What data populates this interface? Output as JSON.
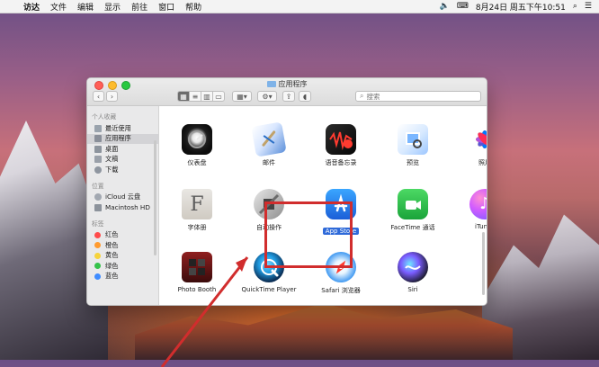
{
  "menubar": {
    "items": [
      "访达",
      "文件",
      "编辑",
      "显示",
      "前往",
      "窗口",
      "帮助"
    ],
    "datetime": "8月24日 周五下午10:51"
  },
  "window": {
    "title": "应用程序",
    "search_placeholder": "搜索"
  },
  "sidebar": {
    "favorites_header": "个人收藏",
    "favorites": [
      "最近使用",
      "应用程序",
      "桌面",
      "文稿",
      "下载"
    ],
    "devices_header": "位置",
    "devices": [
      "iCloud 云盘",
      "Macintosh HD"
    ],
    "tags_header": "标签",
    "tags": [
      {
        "label": "红色",
        "color": "#ff4b4b"
      },
      {
        "label": "橙色",
        "color": "#ff9a2e"
      },
      {
        "label": "黄色",
        "color": "#f6d33c"
      },
      {
        "label": "绿色",
        "color": "#35c24a"
      },
      {
        "label": "蓝色",
        "color": "#3f8cff"
      }
    ]
  },
  "apps": [
    {
      "label": "仪表盘",
      "icon": "dashboard-icon"
    },
    {
      "label": "邮件",
      "icon": "mail-icon"
    },
    {
      "label": "语音备忘录",
      "icon": "voice-memos-icon"
    },
    {
      "label": "预览",
      "icon": "preview-icon"
    },
    {
      "label": "照片",
      "icon": "photos-icon"
    },
    {
      "label": "字体册",
      "icon": "font-book-icon"
    },
    {
      "label": "自动操作",
      "icon": "automator-icon"
    },
    {
      "label": "App Store",
      "icon": "app-store-icon"
    },
    {
      "label": "FaceTime 通话",
      "icon": "facetime-icon"
    },
    {
      "label": "iTunes",
      "icon": "itunes-icon"
    },
    {
      "label": "Photo Booth",
      "icon": "photo-booth-icon"
    },
    {
      "label": "QuickTime Player",
      "icon": "quicktime-icon"
    },
    {
      "label": "Safari 浏览器",
      "icon": "safari-icon"
    },
    {
      "label": "Siri",
      "icon": "siri-icon"
    }
  ],
  "colors": {
    "selection": "#2f6ad9",
    "highlight_box": "#d12d2d"
  }
}
